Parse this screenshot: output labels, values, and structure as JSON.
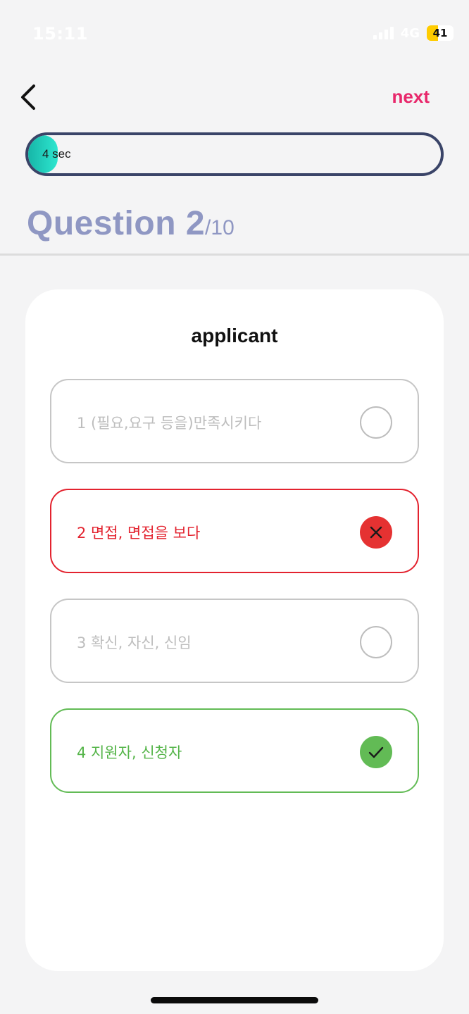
{
  "status_bar": {
    "time": "15:11",
    "network": "4G",
    "battery_level": "41",
    "battery_fraction": 0.41,
    "battery_color": "#ffcc00"
  },
  "header": {
    "back_icon": "chevron-left-icon",
    "next_label": "next",
    "accent_color": "#e8276b"
  },
  "timer": {
    "label": "4 sec",
    "remaining_seconds": 4
  },
  "question": {
    "title": "Question 2",
    "total": "/10"
  },
  "card": {
    "word": "applicant",
    "options": [
      {
        "label": "1 (필요,요구 등을)만족시키다",
        "state": "unselected",
        "icon": "empty-circle-icon"
      },
      {
        "label": "2 면접, 면접을 보다",
        "state": "wrong",
        "icon": "x-mark-icon",
        "color": "#e3232f"
      },
      {
        "label": "3 확신, 자신, 신임",
        "state": "unselected",
        "icon": "empty-circle-icon"
      },
      {
        "label": "4 지원자, 신청자",
        "state": "correct",
        "icon": "check-mark-icon",
        "color": "#62bb55"
      }
    ]
  }
}
